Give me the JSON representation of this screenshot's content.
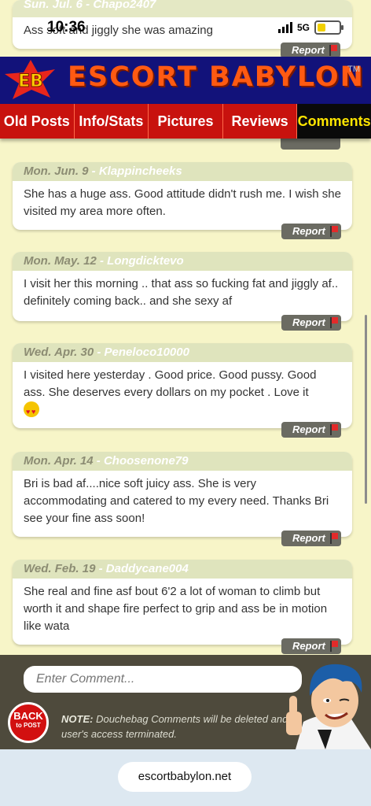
{
  "status_bar": {
    "time": "10:36",
    "network": "5G"
  },
  "top_comment": {
    "header": "Sun. Jul. 6 - Chapo2407",
    "text": "Ass soft and jiggly she was amazing",
    "report_label": "Report"
  },
  "brand": {
    "badge": "EB",
    "title": "ESCORT BABYLON",
    "tm": "TM"
  },
  "nav": {
    "tabs": [
      "Old Posts",
      "Info/Stats",
      "Pictures",
      "Reviews",
      "Comments"
    ],
    "active": "Comments"
  },
  "comments": [
    {
      "date": "Mon. Jun. 9",
      "user": "Klappincheeks",
      "text": "She has a huge ass. Good attitude didn't rush me. I wish she visited my area more often.",
      "report": "Report"
    },
    {
      "date": "Mon. May. 12",
      "user": "Longdicktevo",
      "text": "I visit her this morning .. that ass so fucking fat and jiggly af.. definitely coming back.. and she sexy af",
      "report": "Report"
    },
    {
      "date": "Wed. Apr. 30",
      "user": "Peneloco10000",
      "text": "I visited here yesterday . Good price. Good pussy. Good ass. She deserves every dollars on my pocket . Love it",
      "report": "Report"
    },
    {
      "date": "Mon. Apr. 14",
      "user": "Choosenone79",
      "text": "Bri is bad af....nice soft juicy ass. She is very accommodating and catered to my every need. Thanks Bri see your fine ass soon!",
      "report": "Report"
    },
    {
      "date": "Wed. Feb. 19",
      "user": "Daddycane004",
      "text": "She real and fine asf bout 6'2 a lot of woman to climb but worth it and shape fire perfect to grip and ass be in motion like wata",
      "report": "Report"
    }
  ],
  "footer": {
    "input_placeholder": "Enter Comment...",
    "back_line1": "BACK",
    "back_line2": "to POST",
    "note_label": "NOTE:",
    "note_text": "Douchebag Comments will be deleted and user's access terminated."
  },
  "browser": {
    "url": "escortbabylon.net"
  }
}
